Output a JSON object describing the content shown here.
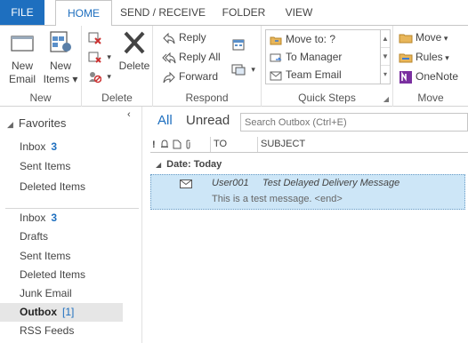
{
  "tabs": {
    "file": "FILE",
    "home": "HOME",
    "send_receive": "SEND / RECEIVE",
    "folder": "FOLDER",
    "view": "VIEW"
  },
  "ribbon": {
    "new": {
      "label": "New",
      "new_email_line1": "New",
      "new_email_line2": "Email",
      "new_items_line1": "New",
      "new_items_line2": "Items"
    },
    "delete": {
      "label": "Delete",
      "delete_button": "Delete"
    },
    "respond": {
      "label": "Respond",
      "reply": "Reply",
      "reply_all": "Reply All",
      "forward": "Forward"
    },
    "quick_steps": {
      "label": "Quick Steps",
      "items": [
        "Move to: ?",
        "To Manager",
        "Team Email"
      ]
    },
    "move": {
      "label": "Move",
      "move": "Move",
      "rules": "Rules",
      "onenote": "OneNote"
    }
  },
  "folders": {
    "favorites_header": "Favorites",
    "favorites": [
      {
        "name": "Inbox",
        "count": "3"
      },
      {
        "name": "Sent Items",
        "count": ""
      },
      {
        "name": "Deleted Items",
        "count": ""
      }
    ],
    "mailbox": [
      {
        "name": "Inbox",
        "count": "3"
      },
      {
        "name": "Drafts",
        "count": ""
      },
      {
        "name": "Sent Items",
        "count": ""
      },
      {
        "name": "Deleted Items",
        "count": ""
      },
      {
        "name": "Junk Email",
        "count": ""
      },
      {
        "name": "Outbox",
        "count": "[1]"
      },
      {
        "name": "RSS Feeds",
        "count": ""
      }
    ]
  },
  "list": {
    "filter_all": "All",
    "filter_unread": "Unread",
    "search_placeholder": "Search Outbox (Ctrl+E)",
    "col_to": "TO",
    "col_subject": "SUBJECT",
    "group_label": "Date: Today",
    "message": {
      "to": "User001",
      "subject": "Test Delayed Delivery Message",
      "preview": "This is a test message. <end>"
    }
  },
  "colors": {
    "accent": "#1e6fbf",
    "selected_row": "#cde6f7",
    "selected_folder": "#e6e6e6"
  }
}
